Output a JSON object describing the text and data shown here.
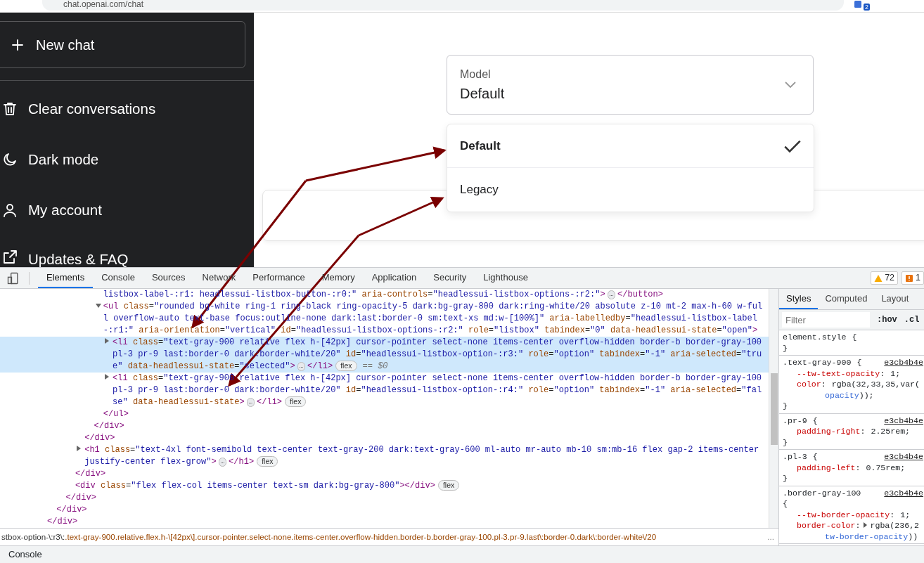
{
  "browser": {
    "url": "chat.openai.com/chat",
    "extension_badge": "2"
  },
  "sidebar": {
    "items": [
      {
        "kind": "button",
        "label": "New chat"
      },
      {
        "kind": "link",
        "label": "Clear conversations"
      },
      {
        "kind": "link",
        "label": "Dark mode"
      },
      {
        "kind": "link",
        "label": "My account"
      },
      {
        "kind": "link",
        "label": "Updates & FAQ"
      }
    ]
  },
  "chat": {
    "model_select": {
      "label": "Model",
      "value": "Default"
    },
    "options": [
      {
        "label": "Default",
        "selected": true
      },
      {
        "label": "Legacy",
        "selected": false
      }
    ]
  },
  "devtools": {
    "tabs": [
      {
        "label": "Elements",
        "selected": true
      },
      {
        "label": "Console",
        "selected": false
      },
      {
        "label": "Sources",
        "selected": false
      },
      {
        "label": "Network",
        "selected": false
      },
      {
        "label": "Performance",
        "selected": false
      },
      {
        "label": "Memory",
        "selected": false
      },
      {
        "label": "Application",
        "selected": false
      },
      {
        "label": "Security",
        "selected": false
      },
      {
        "label": "Lighthouse",
        "selected": false
      }
    ],
    "warnings": "72",
    "errors": "1",
    "dom_tree": [
      {
        "close": "</div>",
        "children": [
          {
            "close": "</div>",
            "children": [
              {
                "close": "</div>",
                "children": [
                  {
                    "close": "</div>",
                    "children": [
                      {
                        "close": "</div>",
                        "children": [
                          {
                            "close": "</div>",
                            "children": [
                              {
                                "open": [
                                  {
                                    "kind": "v",
                                    "text": "listbox-label-:r1: headlessui-listbox-button-:r0:\""
                                  },
                                  {
                                    "kind": "a",
                                    "text": " aria-controls"
                                  },
                                  {
                                    "kind": "p",
                                    "text": "="
                                  },
                                  {
                                    "kind": "v",
                                    "text": "\"headlessui-listbox-options-:r2:\""
                                  },
                                  {
                                    "kind": "t",
                                    "text": ">"
                                  },
                                  {
                                    "kind": "collapsed",
                                    "text": "…"
                                  },
                                  {
                                    "kind": "t",
                                    "text": "</button>"
                                  }
                                ]
                              },
                              {
                                "expanded": true,
                                "open": [
                                  {
                                    "kind": "t",
                                    "text": "<ul"
                                  },
                                  {
                                    "kind": "a",
                                    "text": " class"
                                  },
                                  {
                                    "kind": "p",
                                    "text": "="
                                  },
                                  {
                                    "kind": "v",
                                    "text": "\"rounded bg-white ring-1 ring-black ring-opacity-5 dark:bg-gray-800 dark:ring-white/20 absolute z-10 mt-2 max-h-60 w-full overflow-auto text-base focus:outline-none dark:last:border-0 sm:text-xs md:w-[100%]\""
                                  },
                                  {
                                    "kind": "a",
                                    "text": " aria-labelledby"
                                  },
                                  {
                                    "kind": "p",
                                    "text": "="
                                  },
                                  {
                                    "kind": "v",
                                    "text": "\"headlessui-listbox-label-:r1:\""
                                  },
                                  {
                                    "kind": "a",
                                    "text": " aria-orientation"
                                  },
                                  {
                                    "kind": "p",
                                    "text": "="
                                  },
                                  {
                                    "kind": "v",
                                    "text": "\"vertical\""
                                  },
                                  {
                                    "kind": "a",
                                    "text": " id"
                                  },
                                  {
                                    "kind": "p",
                                    "text": "="
                                  },
                                  {
                                    "kind": "v",
                                    "text": "\"headlessui-listbox-options-:r2:\""
                                  },
                                  {
                                    "kind": "a",
                                    "text": " role"
                                  },
                                  {
                                    "kind": "p",
                                    "text": "="
                                  },
                                  {
                                    "kind": "v",
                                    "text": "\"listbox\""
                                  },
                                  {
                                    "kind": "a",
                                    "text": " tabindex"
                                  },
                                  {
                                    "kind": "p",
                                    "text": "="
                                  },
                                  {
                                    "kind": "v",
                                    "text": "\"0\""
                                  },
                                  {
                                    "kind": "a",
                                    "text": " data-headlessui-state"
                                  },
                                  {
                                    "kind": "p",
                                    "text": "="
                                  },
                                  {
                                    "kind": "v",
                                    "text": "\"open\""
                                  },
                                  {
                                    "kind": "t",
                                    "text": ">"
                                  }
                                ],
                                "close": "</ul>",
                                "children": [
                                  {
                                    "expanded": false,
                                    "selected": true,
                                    "open": [
                                      {
                                        "kind": "t",
                                        "text": "<li"
                                      },
                                      {
                                        "kind": "a",
                                        "text": " class"
                                      },
                                      {
                                        "kind": "p",
                                        "text": "="
                                      },
                                      {
                                        "kind": "v",
                                        "text": "\"text-gray-900 relative flex h-[42px] cursor-pointer select-none items-center overflow-hidden border-b border-gray-100 pl-3 pr-9 last:border-0 dark:border-white/20\""
                                      },
                                      {
                                        "kind": "a",
                                        "text": " id"
                                      },
                                      {
                                        "kind": "p",
                                        "text": "="
                                      },
                                      {
                                        "kind": "v",
                                        "text": "\"headlessui-listbox-option-:r3:\""
                                      },
                                      {
                                        "kind": "a",
                                        "text": " role"
                                      },
                                      {
                                        "kind": "p",
                                        "text": "="
                                      },
                                      {
                                        "kind": "v",
                                        "text": "\"option\""
                                      },
                                      {
                                        "kind": "a",
                                        "text": " tabindex"
                                      },
                                      {
                                        "kind": "p",
                                        "text": "="
                                      },
                                      {
                                        "kind": "v",
                                        "text": "\"-1\""
                                      },
                                      {
                                        "kind": "a",
                                        "text": " aria-selected"
                                      },
                                      {
                                        "kind": "p",
                                        "text": "="
                                      },
                                      {
                                        "kind": "v",
                                        "text": "\"true\""
                                      },
                                      {
                                        "kind": "a",
                                        "text": " data-headlessui-state"
                                      },
                                      {
                                        "kind": "p",
                                        "text": "="
                                      },
                                      {
                                        "kind": "v",
                                        "text": "\"selected\""
                                      },
                                      {
                                        "kind": "t",
                                        "text": ">"
                                      },
                                      {
                                        "kind": "collapsed",
                                        "text": "…"
                                      },
                                      {
                                        "kind": "t",
                                        "text": "</li>"
                                      },
                                      {
                                        "kind": "badge",
                                        "text": "flex"
                                      },
                                      {
                                        "kind": "ref",
                                        "text": "== $0"
                                      }
                                    ]
                                  },
                                  {
                                    "expanded": false,
                                    "selected": false,
                                    "open": [
                                      {
                                        "kind": "t",
                                        "text": "<li"
                                      },
                                      {
                                        "kind": "a",
                                        "text": " class"
                                      },
                                      {
                                        "kind": "p",
                                        "text": "="
                                      },
                                      {
                                        "kind": "v",
                                        "text": "\"text-gray-900 relative flex h-[42px] cursor-pointer select-none items-center overflow-hidden border-b border-gray-100 pl-3 pr-9 last:border-0 dark:border-white/20\""
                                      },
                                      {
                                        "kind": "a",
                                        "text": " id"
                                      },
                                      {
                                        "kind": "p",
                                        "text": "="
                                      },
                                      {
                                        "kind": "v",
                                        "text": "\"headlessui-listbox-option-:r4:\""
                                      },
                                      {
                                        "kind": "a",
                                        "text": " role"
                                      },
                                      {
                                        "kind": "p",
                                        "text": "="
                                      },
                                      {
                                        "kind": "v",
                                        "text": "\"option\""
                                      },
                                      {
                                        "kind": "a",
                                        "text": " tabindex"
                                      },
                                      {
                                        "kind": "p",
                                        "text": "="
                                      },
                                      {
                                        "kind": "v",
                                        "text": "\"-1\""
                                      },
                                      {
                                        "kind": "a",
                                        "text": " aria-selected"
                                      },
                                      {
                                        "kind": "p",
                                        "text": "="
                                      },
                                      {
                                        "kind": "v",
                                        "text": "\"false\""
                                      },
                                      {
                                        "kind": "a",
                                        "text": " data-headlessui-state"
                                      },
                                      {
                                        "kind": "t",
                                        "text": ">"
                                      },
                                      {
                                        "kind": "collapsed",
                                        "text": "…"
                                      },
                                      {
                                        "kind": "t",
                                        "text": "</li>"
                                      },
                                      {
                                        "kind": "badge",
                                        "text": "flex"
                                      }
                                    ]
                                  }
                                ]
                              }
                            ]
                          }
                        ]
                      },
                      {
                        "expanded": false,
                        "open": [
                          {
                            "kind": "t",
                            "text": "<h1"
                          },
                          {
                            "kind": "a",
                            "text": " class"
                          },
                          {
                            "kind": "p",
                            "text": "="
                          },
                          {
                            "kind": "v",
                            "text": "\"text-4xl font-semibold text-center text-gray-200 dark:text-gray-600 ml-auto mr-auto mb-10 sm:mb-16 flex gap-2 items-center justify-center flex-grow\""
                          },
                          {
                            "kind": "t",
                            "text": ">"
                          },
                          {
                            "kind": "collapsed",
                            "text": "…"
                          },
                          {
                            "kind": "t",
                            "text": "</h1>"
                          },
                          {
                            "kind": "badge",
                            "text": "flex"
                          }
                        ]
                      }
                    ]
                  },
                  {
                    "open": [
                      {
                        "kind": "t",
                        "text": "<div"
                      },
                      {
                        "kind": "a",
                        "text": " class"
                      },
                      {
                        "kind": "p",
                        "text": "="
                      },
                      {
                        "kind": "v",
                        "text": "\"flex flex-col items-center text-sm dark:bg-gray-800\""
                      },
                      {
                        "kind": "t",
                        "text": "></div>"
                      },
                      {
                        "kind": "badge",
                        "text": "flex"
                      }
                    ]
                  }
                ]
              }
            ]
          }
        ]
      }
    ],
    "breadcrumb": {
      "element": "stbox-option-\\:r3\\:",
      "classes": ".text-gray-900.relative.flex.h-\\[42px\\].cursor-pointer.select-none.items-center.overflow-hidden.border-b.border-gray-100.pl-3.pr-9.last\\:border-0.dark\\:border-white\\/20",
      "more": "..."
    },
    "styles": {
      "tabs": [
        {
          "label": "Styles",
          "selected": true
        },
        {
          "label": "Computed",
          "selected": false
        },
        {
          "label": "Layout",
          "selected": false
        }
      ],
      "filter_placeholder": "Filter",
      "hov": ":hov",
      "cls": ".cl",
      "rules": [
        {
          "selector": "element.style",
          "brace": "{",
          "close": "}"
        },
        {
          "selector": ".text-gray-900",
          "brace": "{",
          "source": "e3cb4b4e",
          "close": "}",
          "declarations": [
            {
              "property": "--tw-text-opacity",
              "separator": ":",
              "value": "1;"
            },
            {
              "property": "color",
              "separator": ":",
              "value": "rgba(32,33,35,var(",
              "wrap": "opacity",
              "tail": "));"
            }
          ]
        },
        {
          "selector": ".pr-9",
          "brace": "{",
          "source": "e3cb4b4e",
          "close": "}",
          "declarations": [
            {
              "property": "padding-right",
              "separator": ":",
              "value": "2.25rem;"
            }
          ]
        },
        {
          "selector": ".pl-3",
          "brace": "{",
          "source": "e3cb4b4e",
          "close": "}",
          "declarations": [
            {
              "property": "padding-left",
              "separator": ":",
              "value": "0.75rem;"
            }
          ]
        },
        {
          "selector": ".border-gray-100",
          "brace": "{",
          "brace_wrapped": true,
          "source": "e3cb4b4e",
          "declarations": [
            {
              "property": "--tw-border-opacity",
              "separator": ":",
              "value": "1;"
            },
            {
              "property": "border-color",
              "separator": ":",
              "expandable": true,
              "value": "rgba(236,2",
              "wrap": "tw-border-opacity",
              "tail": "))"
            }
          ]
        }
      ]
    },
    "drawer": {
      "tab": "Console"
    }
  }
}
